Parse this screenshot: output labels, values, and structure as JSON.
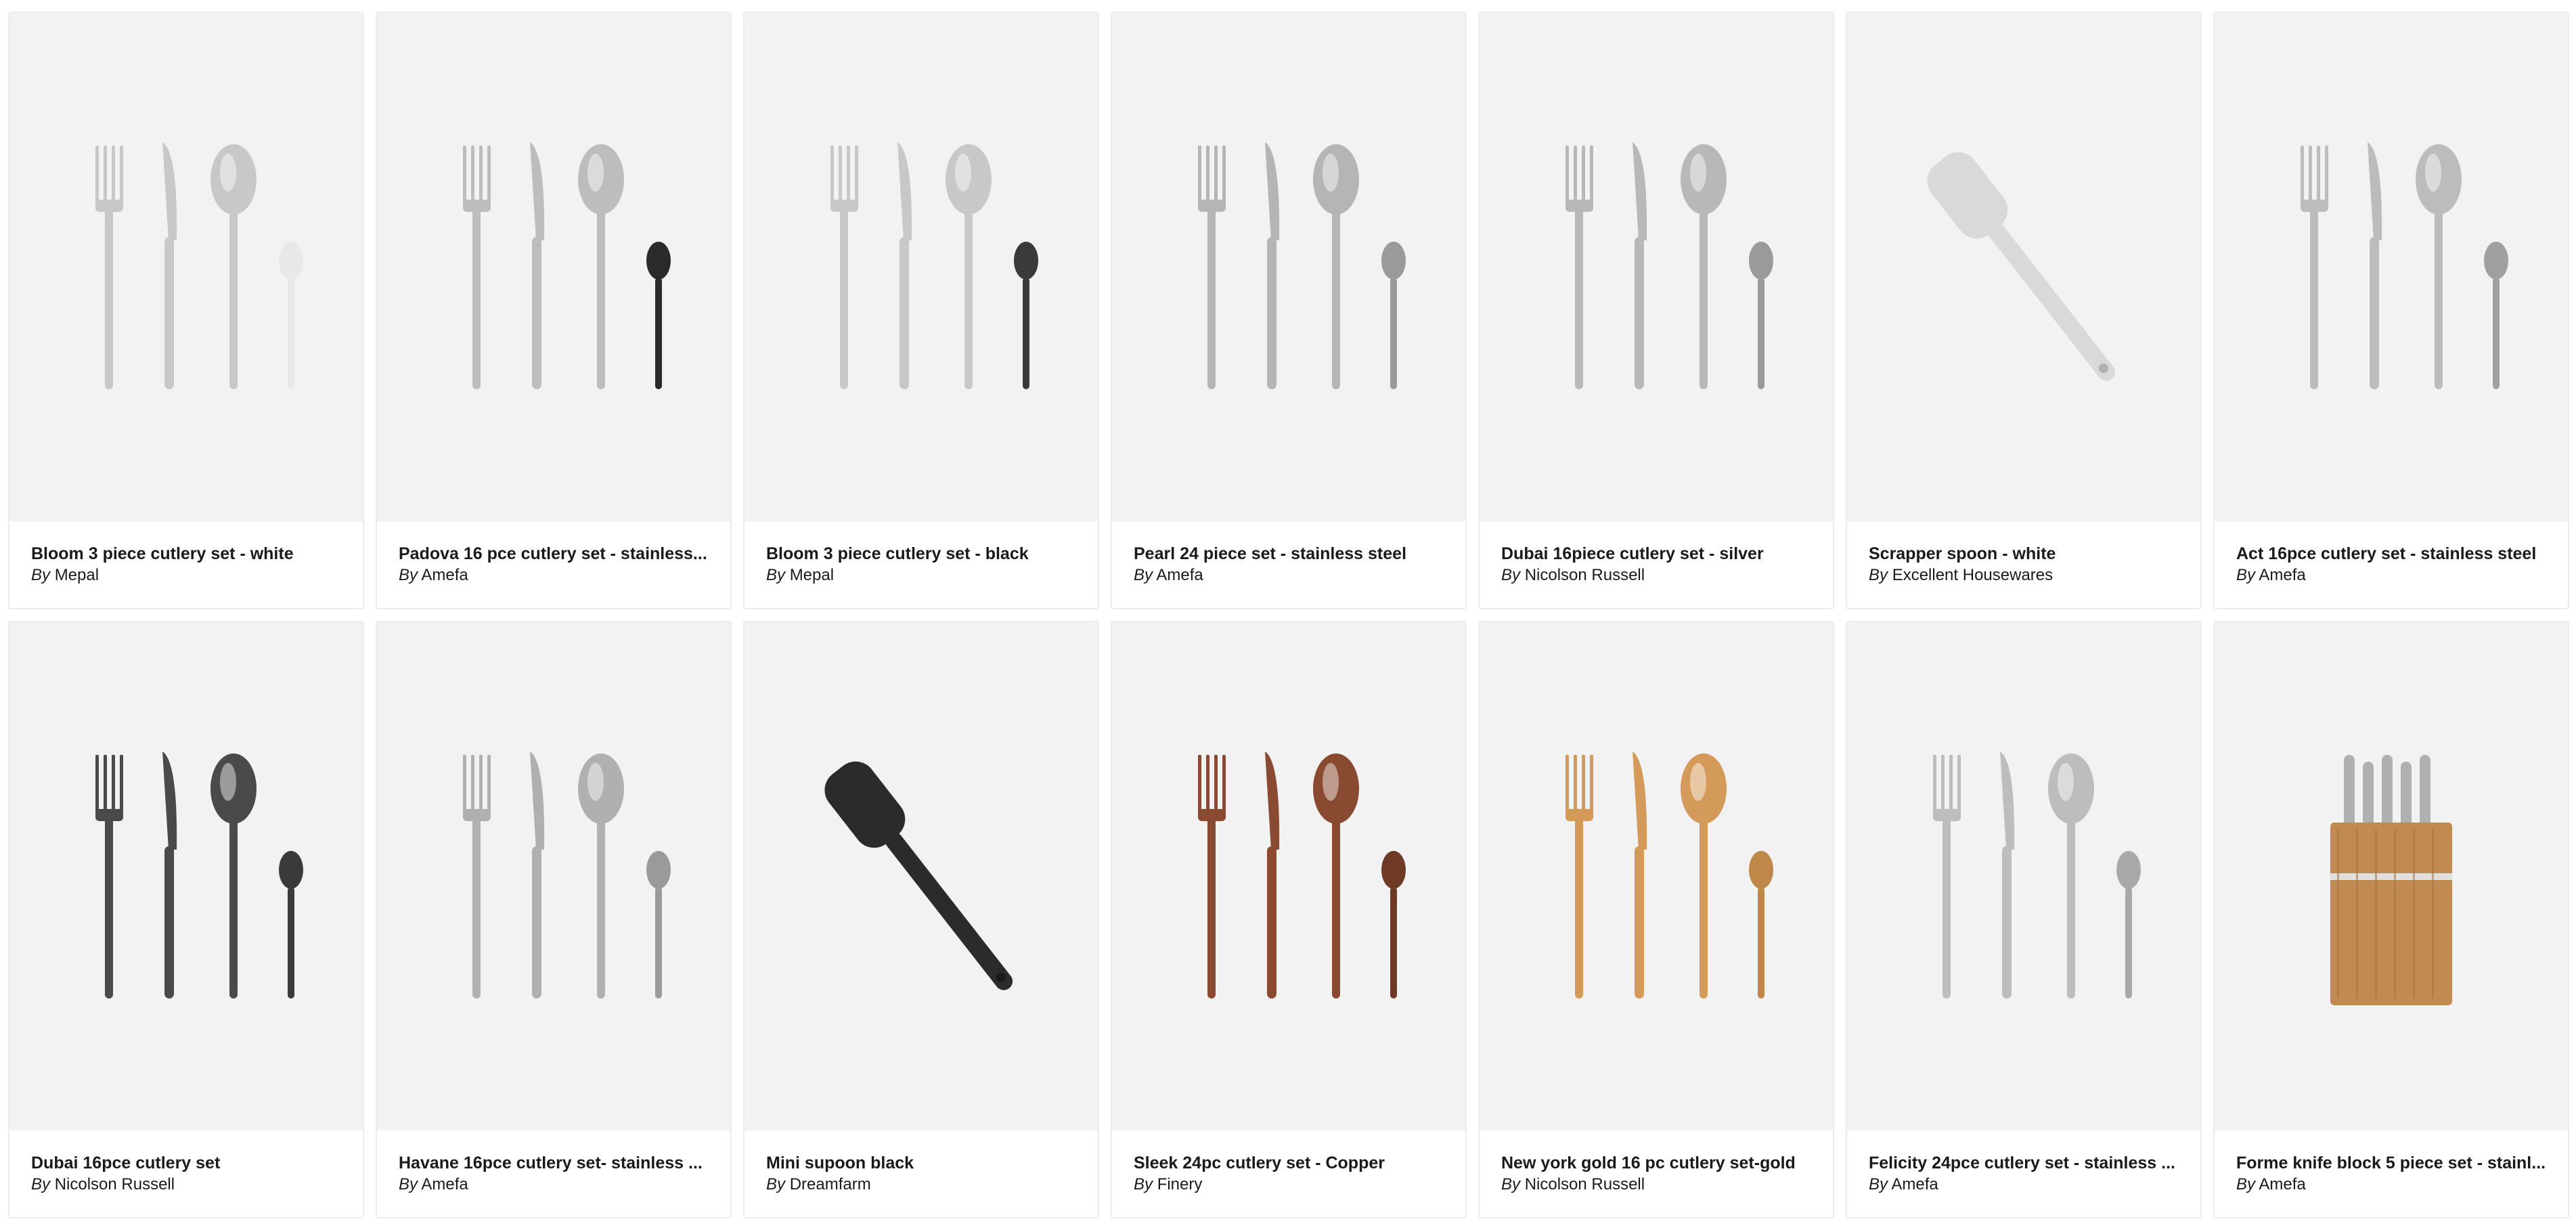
{
  "by_prefix": "By",
  "products": [
    {
      "title": "Bloom 3 piece cutlery set - white",
      "brand": "Mepal",
      "icon": "cutlery-set-icon",
      "color": "#c8c8c8",
      "accent": "#e8e8e8"
    },
    {
      "title": "Padova 16 pce cutlery set - stainless...",
      "brand": "Amefa",
      "icon": "cutlery-set-icon",
      "color": "#bdbdbd",
      "accent": "#2a2a2a"
    },
    {
      "title": "Bloom 3 piece cutlery set - black",
      "brand": "Mepal",
      "icon": "cutlery-set-icon",
      "color": "#c8c8c8",
      "accent": "#3a3a3a"
    },
    {
      "title": "Pearl 24 piece set - stainless steel",
      "brand": "Amefa",
      "icon": "cutlery-set-icon",
      "color": "#b5b5b5",
      "accent": "#9a9a9a"
    },
    {
      "title": "Dubai 16piece cutlery set - silver",
      "brand": "Nicolson Russell",
      "icon": "cutlery-set-icon",
      "color": "#b8b8b8",
      "accent": "#9a9a9a"
    },
    {
      "title": "Scrapper spoon - white",
      "brand": "Excellent Housewares",
      "icon": "spatula-icon",
      "color": "#d9d9d9",
      "accent": "#b0b0b0"
    },
    {
      "title": "Act 16pce cutlery set - stainless steel",
      "brand": "Amefa",
      "icon": "cutlery-set-icon",
      "color": "#bcbcbc",
      "accent": "#a0a0a0"
    },
    {
      "title": "Dubai 16pce cutlery set",
      "brand": "Nicolson Russell",
      "icon": "cutlery-set-icon",
      "color": "#4a4a4a",
      "accent": "#3a3a3a"
    },
    {
      "title": "Havane 16pce cutlery set- stainless ...",
      "brand": "Amefa",
      "icon": "cutlery-set-icon",
      "color": "#b0b0b0",
      "accent": "#9a9a9a"
    },
    {
      "title": "Mini supoon black",
      "brand": "Dreamfarm",
      "icon": "spatula-icon",
      "color": "#2b2b2b",
      "accent": "#1a1a1a"
    },
    {
      "title": "Sleek 24pc cutlery set - Copper",
      "brand": "Finery",
      "icon": "cutlery-set-icon",
      "color": "#8a4a32",
      "accent": "#6e3a26"
    },
    {
      "title": "New york gold 16 pc cutlery set-gold",
      "brand": "Nicolson Russell",
      "icon": "cutlery-set-icon",
      "color": "#d49a5a",
      "accent": "#c08848"
    },
    {
      "title": "Felicity 24pce cutlery set - stainless ...",
      "brand": "Amefa",
      "icon": "cutlery-set-icon",
      "color": "#bdbdbd",
      "accent": "#a8a8a8"
    },
    {
      "title": "Forme knife block 5 piece set - stainl...",
      "brand": "Amefa",
      "icon": "knife-block-icon",
      "color": "#c08a50",
      "accent": "#b0b0b0"
    }
  ]
}
